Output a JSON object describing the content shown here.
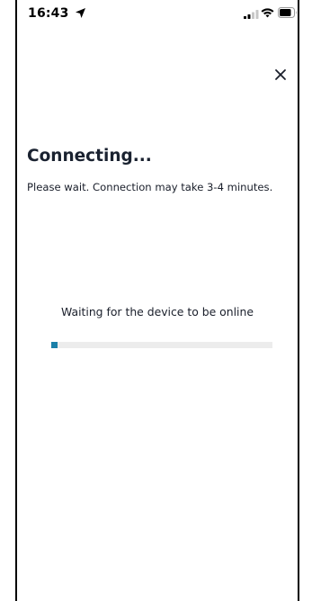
{
  "status_bar": {
    "time": "16:43",
    "location_icon": "location-arrow-icon",
    "signal_icon": "cellular-signal-icon",
    "wifi_icon": "wifi-icon",
    "battery_icon": "battery-icon"
  },
  "header": {
    "close_icon": "close-icon"
  },
  "main": {
    "title": "Connecting...",
    "subtitle": "Please wait. Connection may take 3-4 minutes.",
    "status_message": "Waiting for the device to be online",
    "progress_fraction": 0.03
  },
  "colors": {
    "accent": "#1a7fa8",
    "progress_track": "#ececec",
    "text": "#1a1f2b"
  }
}
